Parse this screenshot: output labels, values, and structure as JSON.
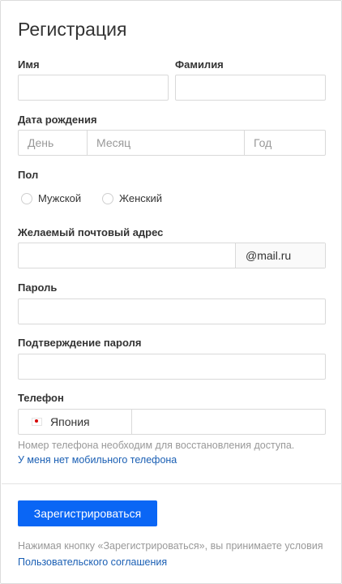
{
  "form": {
    "title": "Регистрация",
    "first_name_label": "Имя",
    "last_name_label": "Фамилия",
    "birth_label": "Дата рождения",
    "birth_day_placeholder": "День",
    "birth_month_placeholder": "Месяц",
    "birth_year_placeholder": "Год",
    "gender_label": "Пол",
    "gender_male": "Мужской",
    "gender_female": "Женский",
    "email_label": "Желаемый почтовый адрес",
    "email_domain": "@mail.ru",
    "password_label": "Пароль",
    "password_confirm_label": "Подтверждение пароля",
    "phone_label": "Телефон",
    "phone_country": "Япония",
    "phone_hint": "Номер телефона необходим для восстановления доступа.",
    "no_phone_link": "У меня нет мобильного телефона",
    "submit_label": "Зарегистрироваться",
    "terms_prefix": "Нажимая кнопку «Зарегистрироваться», вы принимаете условия",
    "terms_link": "Пользовательского соглашения"
  },
  "icons": {
    "country_flag": "japan-flag-icon"
  },
  "colors": {
    "accent": "#0a66f5",
    "link": "#1a5fb4",
    "hint": "#999999",
    "border": "#d9d9d9"
  }
}
